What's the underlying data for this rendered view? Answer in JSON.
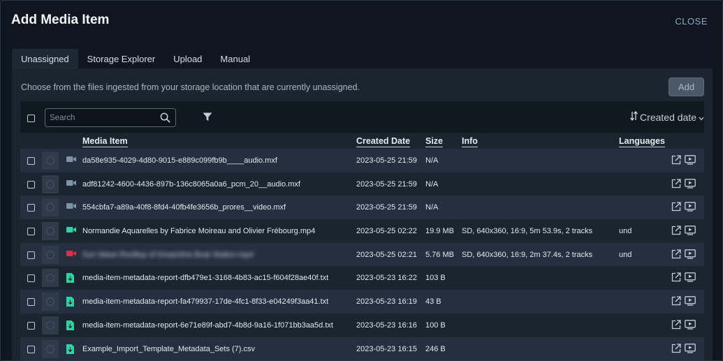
{
  "modal": {
    "title": "Add Media Item",
    "close_label": "CLOSE"
  },
  "tabs": [
    {
      "label": "Unassigned",
      "active": true
    },
    {
      "label": "Storage Explorer",
      "active": false
    },
    {
      "label": "Upload",
      "active": false
    },
    {
      "label": "Manual",
      "active": false
    }
  ],
  "panel": {
    "description": "Choose from the files ingested from your storage location that are currently unassigned.",
    "add_label": "Add"
  },
  "toolbar": {
    "search_placeholder": "Search",
    "sort_label": "Created date",
    "icons": [
      "search-icon",
      "filter-icon",
      "sort-icon",
      "chevron-down-icon"
    ]
  },
  "columns": {
    "media_item": "Media Item",
    "created_date": "Created Date",
    "size": "Size",
    "info": "Info",
    "languages": "Languages"
  },
  "colors": {
    "video_gray": "#7f93a8",
    "video_green": "#2ed3a2",
    "video_red": "#d6304b",
    "file_green": "#2ed3a2"
  },
  "rows": [
    {
      "name": "da58e935-4029-4d80-9015-e889c099fb9b____audio.mxf",
      "date": "2023-05-25 21:59",
      "size": "N/A",
      "info": "",
      "lang": "",
      "icon": "video-icon",
      "color": "#7f93a8",
      "blurred": false
    },
    {
      "name": "adf81242-4600-4436-897b-136c8065a0a6_pcm_20__audio.mxf",
      "date": "2023-05-25 21:59",
      "size": "N/A",
      "info": "",
      "lang": "",
      "icon": "video-icon",
      "color": "#7f93a8",
      "blurred": false
    },
    {
      "name": "554cbfa7-a89a-40f8-8fd4-40fb4fe3656b_prores__video.mxf",
      "date": "2023-05-25 21:59",
      "size": "N/A",
      "info": "",
      "lang": "",
      "icon": "video-icon",
      "color": "#7f93a8",
      "blurred": false
    },
    {
      "name": "Normandie Aquarelles by Fabrice Moireau and Olivier Frébourg.mp4",
      "date": "2023-05-25 02:22",
      "size": "19.9 MB",
      "info": "SD, 640x360, 16:9, 5m 53.9s, 2 tracks",
      "lang": "und",
      "icon": "video-icon",
      "color": "#2ed3a2",
      "blurred": false
    },
    {
      "name": "Sun Wave Rooftop of Dreamline Boat Station.mp4",
      "date": "2023-05-25 02:21",
      "size": "5.76 MB",
      "info": "SD, 640x360, 16:9, 2m 37.4s, 2 tracks",
      "lang": "und",
      "icon": "video-icon",
      "color": "#d6304b",
      "blurred": true
    },
    {
      "name": "media-item-metadata-report-dfb479e1-3168-4b83-ac15-f604f28ae40f.txt",
      "date": "2023-05-23 16:22",
      "size": "103 B",
      "info": "",
      "lang": "",
      "icon": "file-icon",
      "color": "#2ed3a2",
      "blurred": false
    },
    {
      "name": "media-item-metadata-report-fa479937-17de-4fc1-8f33-e04249f3aa41.txt",
      "date": "2023-05-23 16:19",
      "size": "43 B",
      "info": "",
      "lang": "",
      "icon": "file-icon",
      "color": "#2ed3a2",
      "blurred": false
    },
    {
      "name": "media-item-metadata-report-6e71e89f-abd7-4b8d-9a16-1f071bb3aa5d.txt",
      "date": "2023-05-23 16:16",
      "size": "100 B",
      "info": "",
      "lang": "",
      "icon": "file-icon",
      "color": "#2ed3a2",
      "blurred": false
    },
    {
      "name": "Example_Import_Template_Metadata_Sets (7).csv",
      "date": "2023-05-23 16:15",
      "size": "246 B",
      "info": "",
      "lang": "",
      "icon": "file-icon",
      "color": "#2ed3a2",
      "blurred": false
    }
  ]
}
